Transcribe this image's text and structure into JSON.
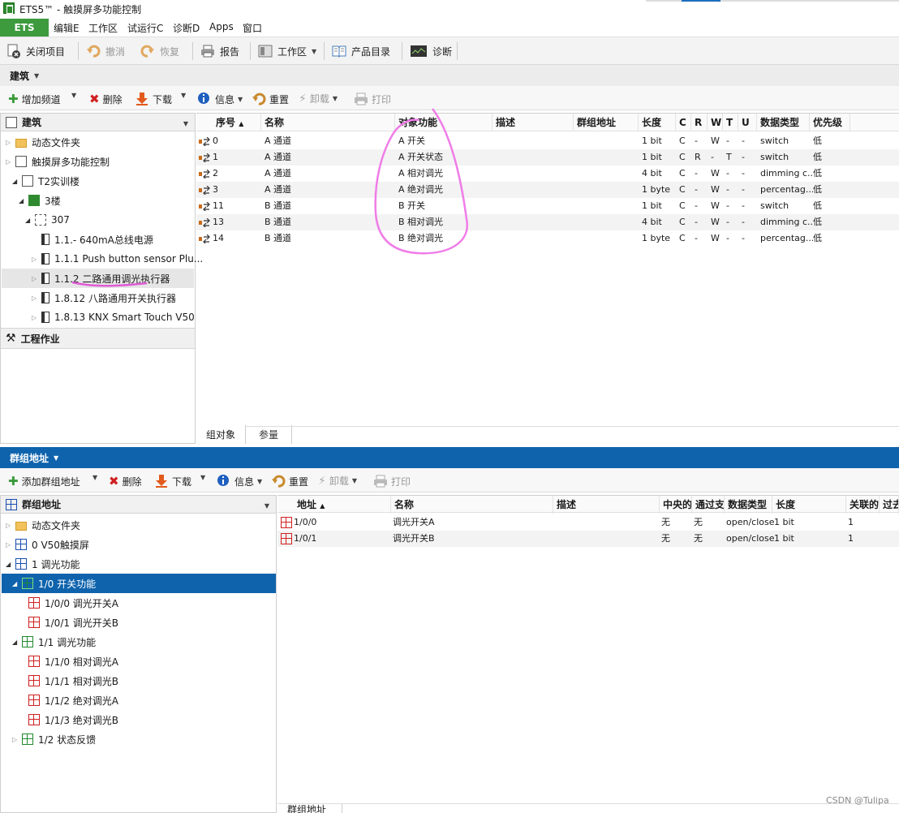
{
  "app": {
    "title": "ETS5™ - 触摸屏多功能控制"
  },
  "menu": {
    "ets": "ETS",
    "items": [
      "编辑E",
      "工作区",
      "试运行C",
      "诊断D",
      "Apps",
      "窗口"
    ]
  },
  "toolbar": {
    "close": "关闭项目",
    "undo": "撤消",
    "redo": "恢复",
    "report": "报告",
    "workspace": "工作区",
    "catalog": "产品目录",
    "diagnose": "诊断"
  },
  "building": {
    "header": "建筑",
    "toolbar": {
      "add_channel": "增加频道",
      "delete": "删除",
      "download": "下载",
      "info": "信息",
      "reset": "重置",
      "unload": "卸载",
      "print": "打印"
    },
    "tree": {
      "header": "建筑",
      "nodes": [
        "动态文件夹",
        "触摸屏多功能控制",
        "T2实训楼",
        "3楼",
        "307",
        "1.1.- 640mA总线电源",
        "1.1.1 Push button sensor Plu...",
        "1.1.2 二路通用调光执行器",
        "1.8.12 八路通用开关执行器",
        "1.8.13 KNX Smart Touch V50"
      ],
      "footer": "工程作业"
    },
    "table": {
      "columns": [
        "序号",
        "名称",
        "对象功能",
        "描述",
        "群组地址",
        "长度",
        "C",
        "R",
        "W",
        "T",
        "U",
        "数据类型",
        "优先级"
      ],
      "rows": [
        [
          "0",
          "A 通道",
          "A 开关",
          "",
          "",
          "1 bit",
          "C",
          "-",
          "W",
          "-",
          "-",
          "switch",
          "低"
        ],
        [
          "1",
          "A 通道",
          "A 开关状态",
          "",
          "",
          "1 bit",
          "C",
          "R",
          "-",
          "T",
          "-",
          "switch",
          "低"
        ],
        [
          "2",
          "A 通道",
          "A 相对调光",
          "",
          "",
          "4 bit",
          "C",
          "-",
          "W",
          "-",
          "-",
          "dimming c...",
          "低"
        ],
        [
          "3",
          "A 通道",
          "A 绝对调光",
          "",
          "",
          "1 byte",
          "C",
          "-",
          "W",
          "-",
          "-",
          "percentag...",
          "低"
        ],
        [
          "11",
          "B 通道",
          "B 开关",
          "",
          "",
          "1 bit",
          "C",
          "-",
          "W",
          "-",
          "-",
          "switch",
          "低"
        ],
        [
          "13",
          "B 通道",
          "B 相对调光",
          "",
          "",
          "4 bit",
          "C",
          "-",
          "W",
          "-",
          "-",
          "dimming c...",
          "低"
        ],
        [
          "14",
          "B 通道",
          "B 绝对调光",
          "",
          "",
          "1 byte",
          "C",
          "-",
          "W",
          "-",
          "-",
          "percentag...",
          "低"
        ]
      ],
      "tabs": [
        "组对象",
        "参量"
      ]
    }
  },
  "groups": {
    "header": "群组地址",
    "toolbar": {
      "add": "添加群组地址",
      "delete": "删除",
      "download": "下载",
      "info": "信息",
      "reset": "重置",
      "unload": "卸载",
      "print": "打印"
    },
    "tree": {
      "header": "群组地址",
      "nodes": [
        "动态文件夹",
        "0 V50触摸屏",
        "1 调光功能",
        "1/0 开关功能",
        "1/0/0 调光开关A",
        "1/0/1 调光开关B",
        "1/1 调光功能",
        "1/1/0 相对调光A",
        "1/1/1 相对调光B",
        "1/1/2 绝对调光A",
        "1/1/3 绝对调光B",
        "1/2 状态反馈"
      ]
    },
    "table": {
      "columns": [
        "地址",
        "名称",
        "描述",
        "中央的",
        "通过支",
        "数据类型",
        "长度",
        "关联的",
        "过去"
      ],
      "rows": [
        [
          "1/0/0",
          "调光开关A",
          "",
          "无",
          "无",
          "open/close",
          "1 bit",
          "1"
        ],
        [
          "1/0/1",
          "调光开关B",
          "",
          "无",
          "无",
          "open/close",
          "1 bit",
          "1"
        ]
      ],
      "tab": "群组地址"
    }
  },
  "watermark": "CSDN @Tulipa",
  "colors": {
    "accent": "#0f63ad",
    "ets_green": "#3d9a3d",
    "selection": "#0f63ad",
    "annotation": "#f07ce8"
  }
}
